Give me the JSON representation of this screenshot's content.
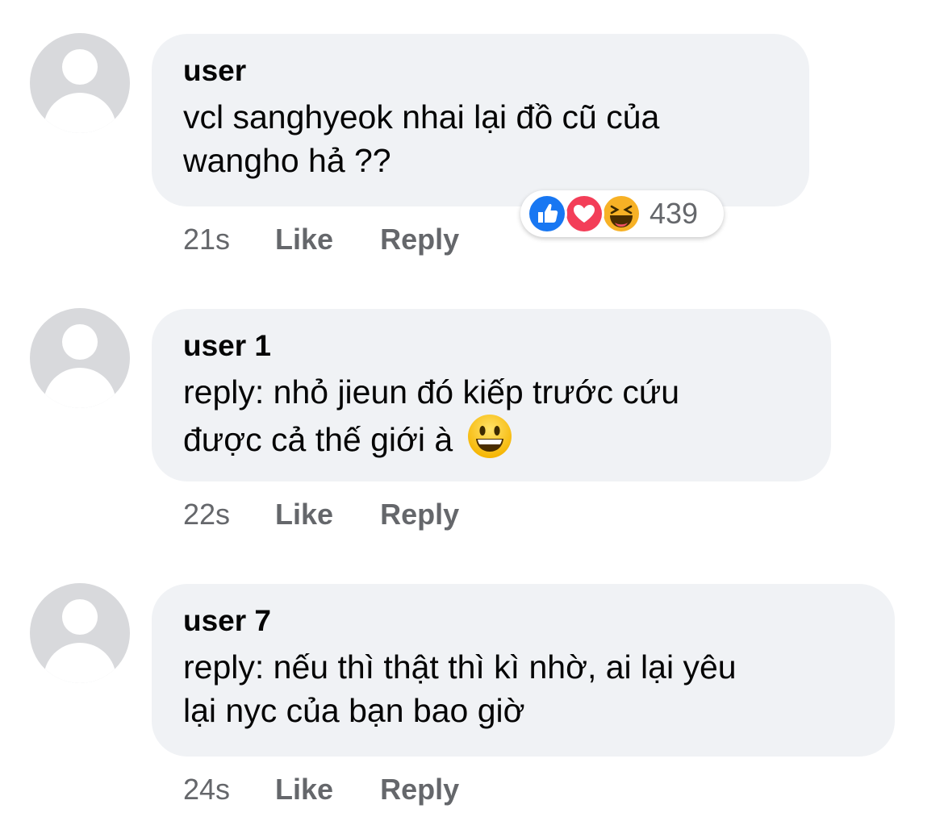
{
  "comments": [
    {
      "author": "user",
      "text_line1": "vcl sanghyeok nhai lại đồ cũ của",
      "text_line2": "wangho hả ??",
      "time": "21s",
      "like_label": "Like",
      "reply_label": "Reply",
      "reactions": {
        "icons": [
          "like-icon",
          "love-icon",
          "haha-icon"
        ],
        "count": "439"
      }
    },
    {
      "author": "user 1",
      "text_line1": "reply: nhỏ jieun đó kiếp trước cứu",
      "text_line2": "được cả thế giới à",
      "emoji": "grinning-face-emoji",
      "time": "22s",
      "like_label": "Like",
      "reply_label": "Reply"
    },
    {
      "author": "user 7",
      "text_line1": "reply: nếu thì thật thì kì nhờ, ai lại yêu",
      "text_line2": "lại nyc của bạn bao giờ",
      "time": "24s",
      "like_label": "Like",
      "reply_label": "Reply"
    }
  ],
  "colors": {
    "bubble_bg": "#f0f2f5",
    "text": "#050505",
    "meta_text": "#65676b",
    "avatar_bg": "#d8d9dc",
    "like_blue": "#1877f2",
    "love_red": "#f33e58",
    "haha_yellow": "#f7b125"
  }
}
